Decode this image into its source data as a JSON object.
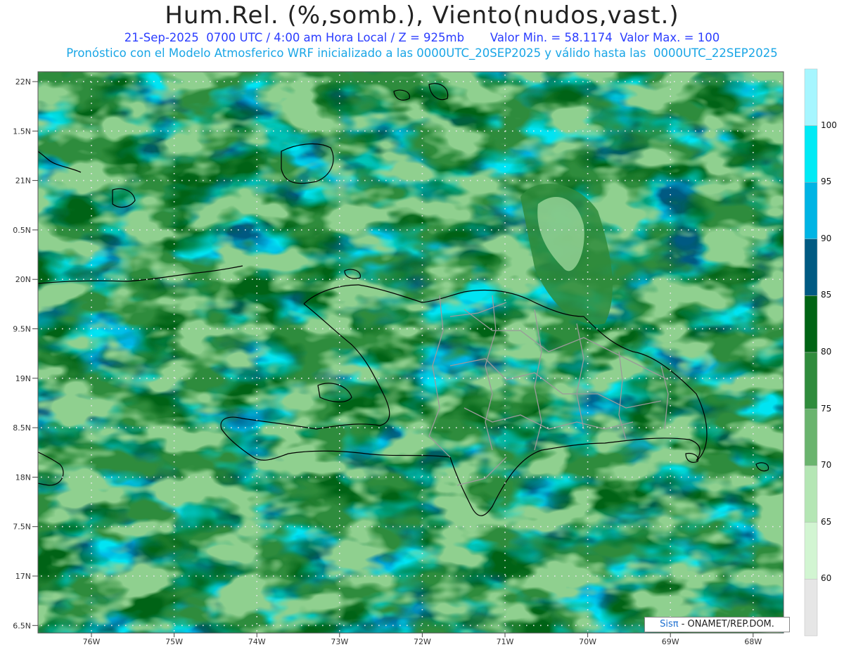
{
  "title": "Hum.Rel. (%,somb.), Viento(nudos,vast.)",
  "subtitle_line1": "21-Sep-2025  0700 UTC / 4:00 am Hora Local / Z = 925mb       Valor Min. = 58.1174  Valor Max. = 100",
  "subtitle_line2": "Pronóstico con el Modelo Atmosferico WRF inicializado a las 0000UTC_20SEP2025 y válido hasta las  0000UTC_22SEP2025",
  "lat_labels": [
    "22N",
    "1.5N",
    "21N",
    "0.5N",
    "20N",
    "9.5N",
    "19N",
    "8.5N",
    "18N",
    "7.5N",
    "17N",
    "6.5N"
  ],
  "lon_labels": [
    "76W",
    "75W",
    "74W",
    "73W",
    "72W",
    "71W",
    "70W",
    "69W",
    "68W"
  ],
  "colorbar": {
    "labels": [
      "100",
      "95",
      "90",
      "85",
      "80",
      "75",
      "70",
      "65",
      "60"
    ],
    "colors": [
      "#a6f6ff",
      "#00eaf5",
      "#00b4e4",
      "#005a82",
      "#006414",
      "#2f8c3c",
      "#6ab46e",
      "#b4e6b4",
      "#d2f5d2",
      "#e6e6e6"
    ]
  },
  "field_palette": {
    "dark_blue": "#005a82",
    "cyan": "#00b4e4",
    "light_cyan": "#00eaf5",
    "dark_green": "#006414",
    "mid_green": "#2f8c3c",
    "light_green": "#6ab46e",
    "pale_green": "#b4e6b4"
  },
  "credit": {
    "brand": "Sisπ",
    "text": " - ONAMET/REP.DOM."
  }
}
